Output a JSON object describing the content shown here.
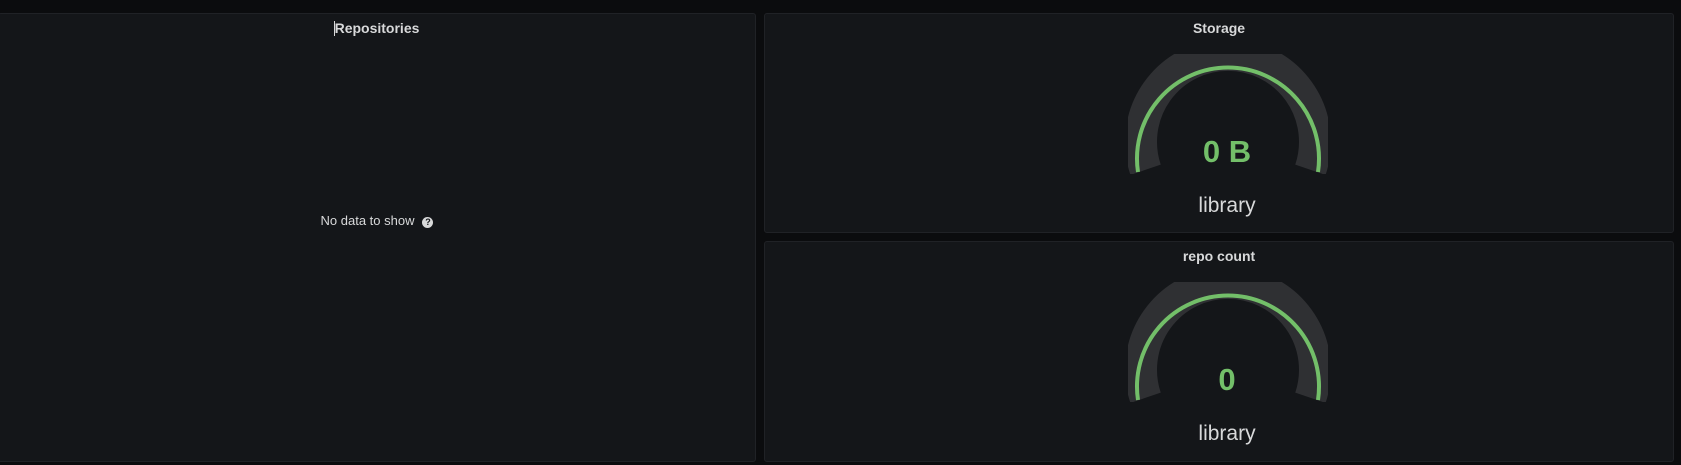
{
  "panels": {
    "repositories": {
      "title": "Repositories",
      "empty_message": "No data to show",
      "help_icon": "question-circle-icon"
    },
    "storage": {
      "title": "Storage",
      "gauge": {
        "value": "0 B",
        "label": "library",
        "fill_fraction": 0,
        "color_threshold": "#73bf69",
        "color_track": "#2f3033"
      }
    },
    "repo_count": {
      "title": "repo count",
      "gauge": {
        "value": "0",
        "label": "library",
        "fill_fraction": 0,
        "color_threshold": "#73bf69",
        "color_track": "#2f3033"
      }
    }
  }
}
